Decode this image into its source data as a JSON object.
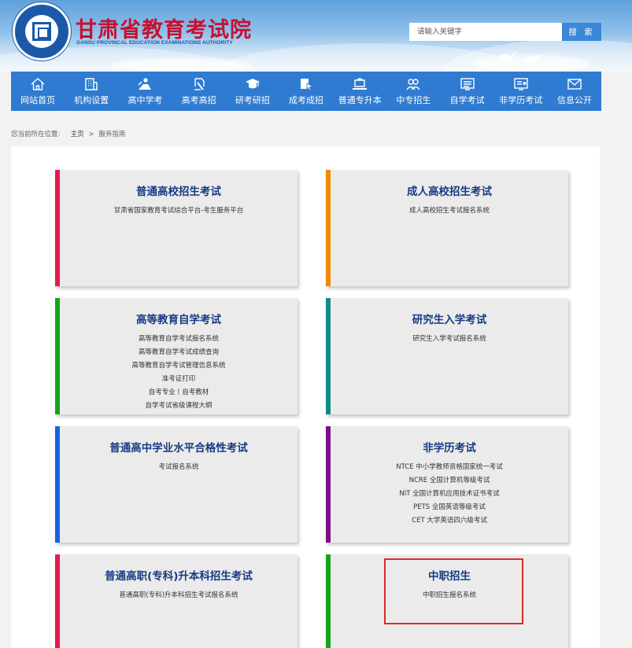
{
  "header": {
    "site_title": "甘肃省教育考试院",
    "site_subtitle": "GANSU PROVINCAL EDUCATION EXAMINATIONS AUTHORITY",
    "logo_icon": "education-authority-seal",
    "search": {
      "placeholder": "请输入关键字",
      "button_label": "搜 索"
    }
  },
  "nav": {
    "items": [
      {
        "label": "网站首页",
        "icon": "home-icon"
      },
      {
        "label": "机构设置",
        "icon": "building-icon"
      },
      {
        "label": "高中学考",
        "icon": "student-icon"
      },
      {
        "label": "高考高招",
        "icon": "pen-icon"
      },
      {
        "label": "研考研招",
        "icon": "graduation-cap-icon"
      },
      {
        "label": "成考成招",
        "icon": "book-pointer-icon"
      },
      {
        "label": "普通专升本",
        "icon": "laptop-student-icon"
      },
      {
        "label": "中专招生",
        "icon": "users-icon"
      },
      {
        "label": "自学考试",
        "icon": "monitor-list-icon"
      },
      {
        "label": "非学历考试",
        "icon": "certificate-icon"
      },
      {
        "label": "信息公开",
        "icon": "mail-icon"
      }
    ]
  },
  "breadcrumb": {
    "prefix": "您当前所在位置:",
    "home": "主页",
    "separator": ">",
    "current": "服务指南"
  },
  "cards": [
    {
      "title": "普通高校招生考试",
      "color": "#e8194d",
      "links": [
        "甘肃省国家教育考试综合平台-考生服务平台"
      ]
    },
    {
      "title": "成人高校招生考试",
      "color": "#f08a00",
      "links": [
        "成人高校招生考试报名系统"
      ]
    },
    {
      "title": "高等教育自学考试",
      "color": "#12a51c",
      "links": [
        "高等教育自学考试报名系统",
        "高等教育自学考试成绩查询",
        "高等教育自学考试管理信息系统",
        "准考证打印",
        "自考专业丨自考教材",
        "自学考试省级课程大纲"
      ]
    },
    {
      "title": "研究生入学考试",
      "color": "#0f8a86",
      "links": [
        "研究生入学考试报名系统"
      ]
    },
    {
      "title": "普通高中学业水平合格性考试",
      "color": "#1463e6",
      "links": [
        "考试报名系统"
      ]
    },
    {
      "title": "非学历考试",
      "color": "#7b0f86",
      "links": [
        "NTCE 中小学教师资格国家统一考试",
        "NCRE 全国计算机等级考试",
        "NIT 全国计算机应用技术证书考试",
        "PETS 全国英语等级考试",
        "CET 大学英语四六级考试"
      ]
    },
    {
      "title": "普通高职(专科)升本科招生考试",
      "color": "#e8194d",
      "links": [
        "普通高职(专科)升本科招生考试报名系统"
      ]
    },
    {
      "title": "中职招生",
      "color": "#12a51c",
      "links": [
        "中职招生报名系统"
      ]
    }
  ]
}
